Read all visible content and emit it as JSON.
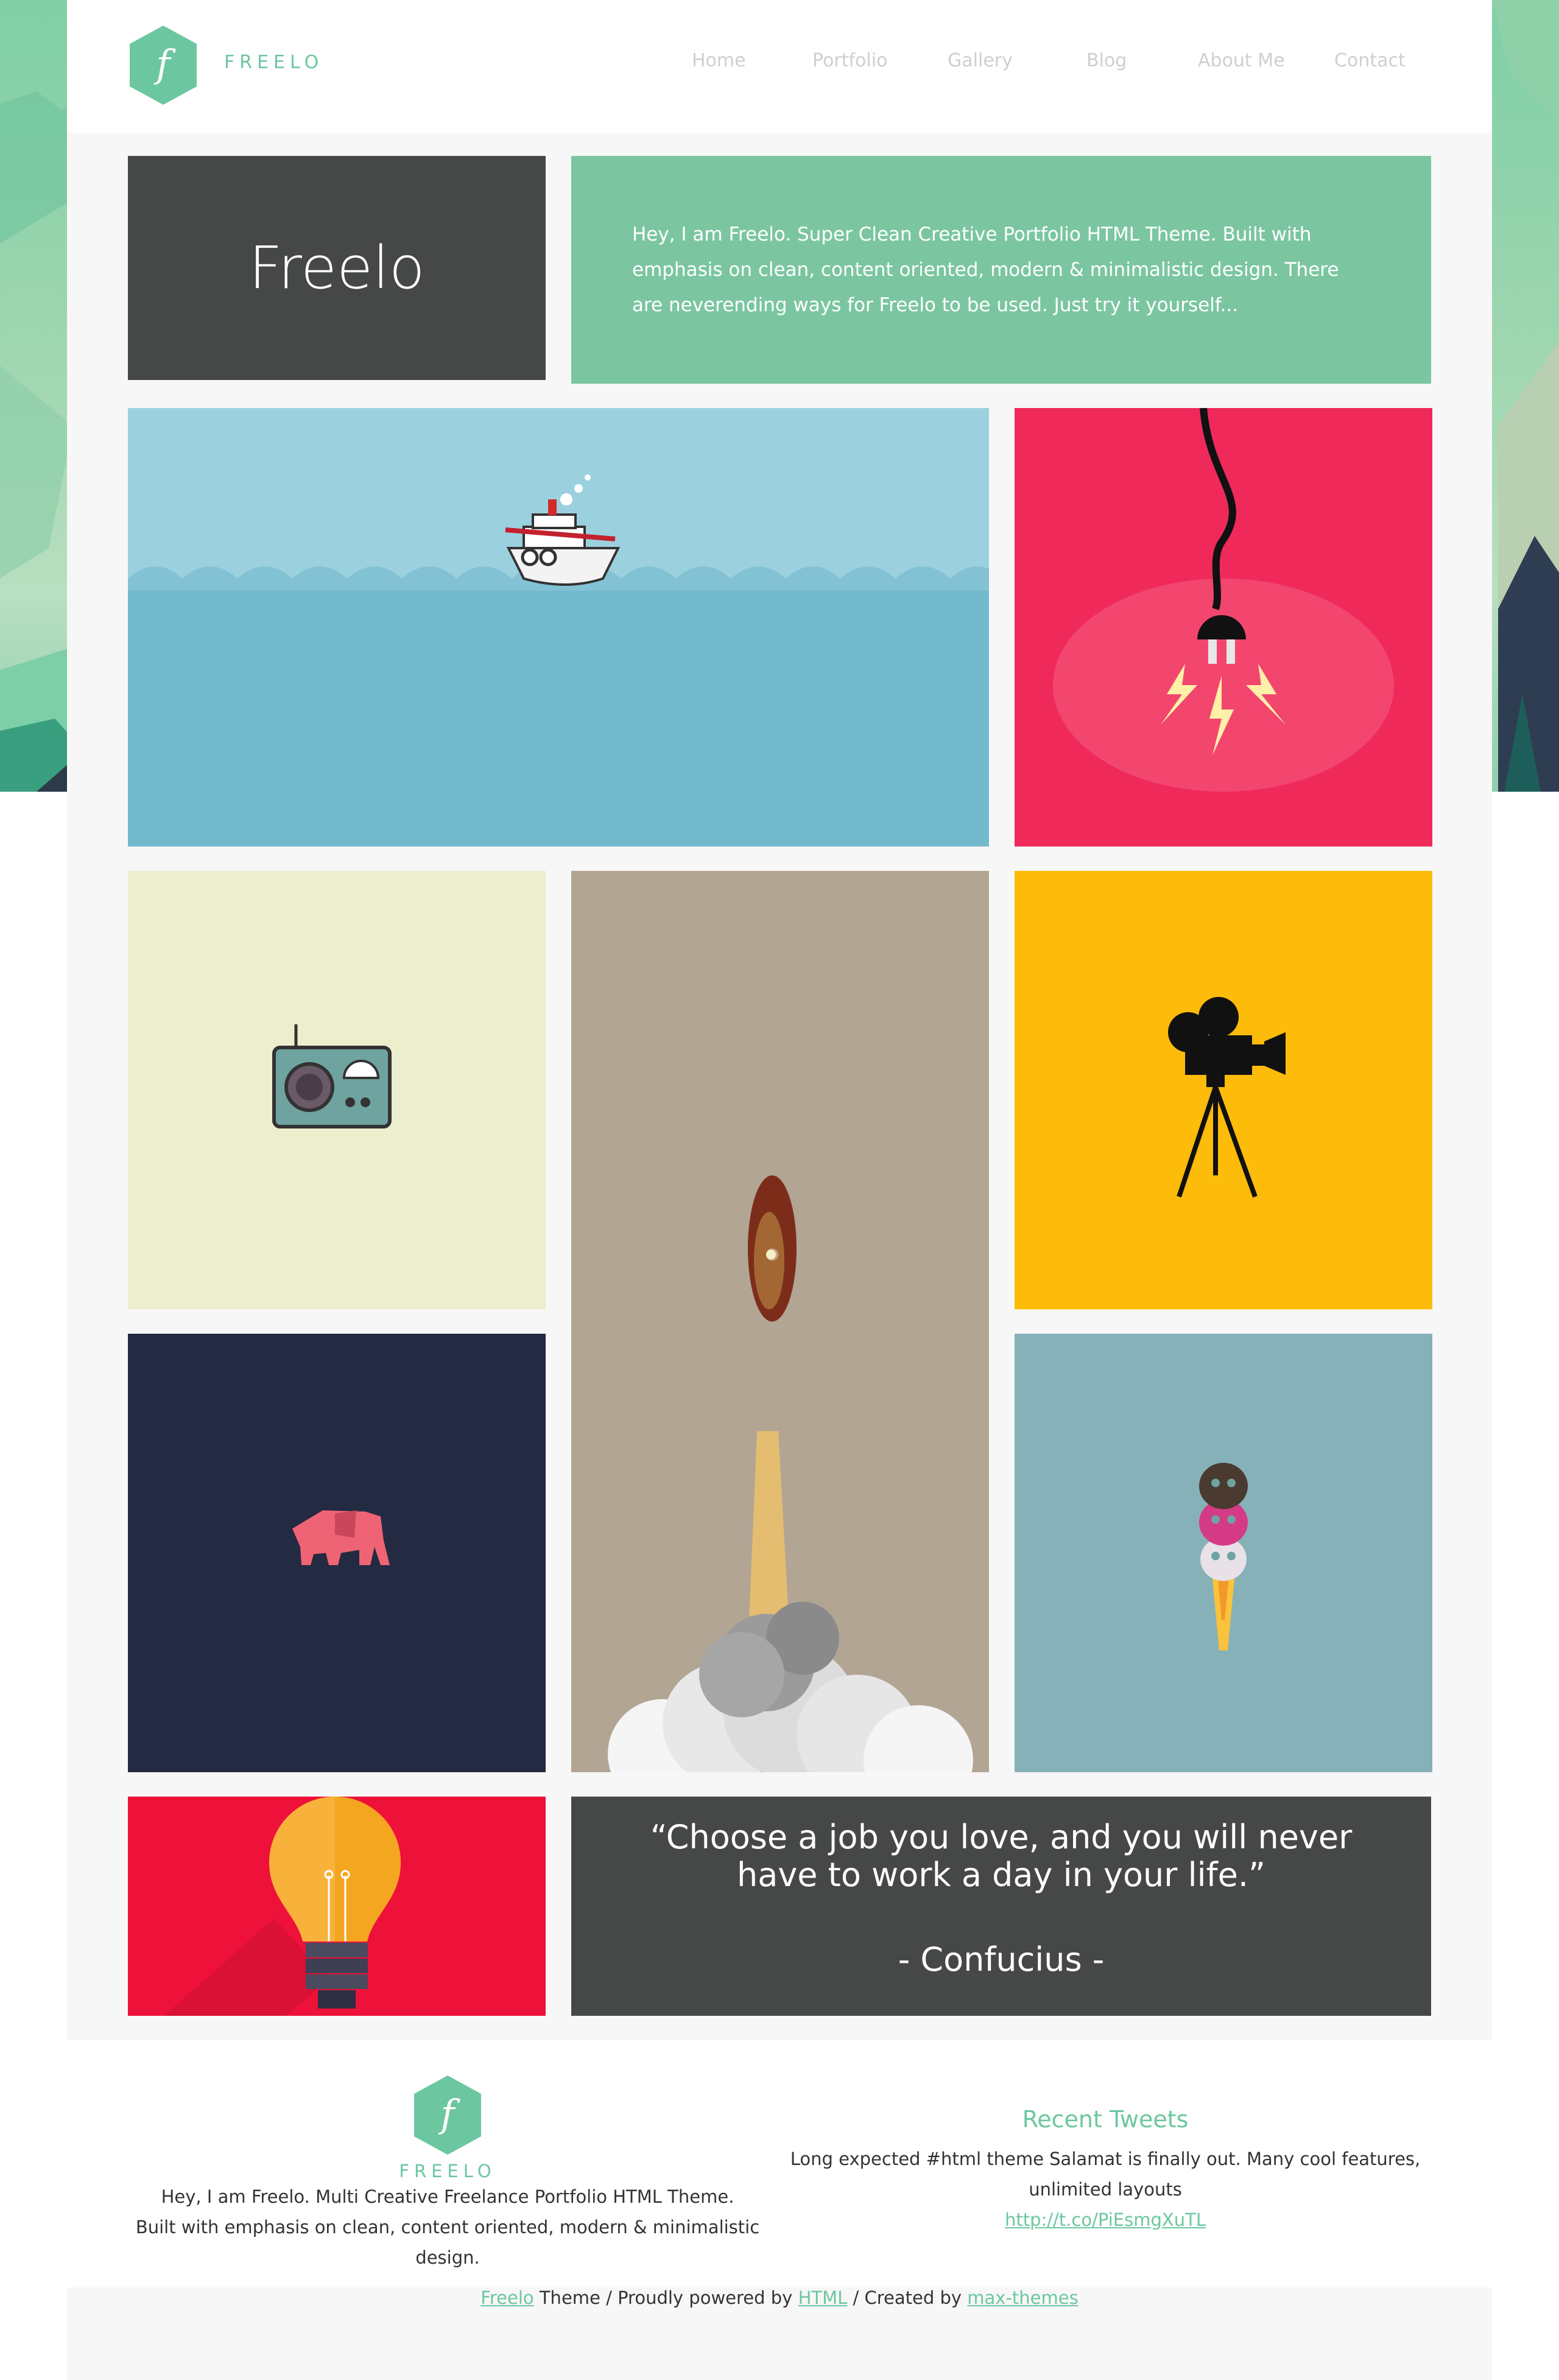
{
  "header": {
    "logo_letter": "f",
    "brand": "FREELO",
    "nav": [
      "Home",
      "Portfolio",
      "Gallery",
      "Blog",
      "About Me",
      "Contact"
    ]
  },
  "hero": {
    "title": "Freelo",
    "intro": "Hey, I am Freelo. Super Clean Creative Portfolio HTML Theme. Built with emphasis on clean, content oriented, modern & minimalistic design. There are neverending ways for Freelo to be used. Just try it yourself..."
  },
  "portfolio": {
    "items": [
      {
        "icon": "boat-illustration",
        "color": "#7fc4d6"
      },
      {
        "icon": "plug-illustration",
        "color": "#ef2a5a"
      },
      {
        "icon": "radio-illustration",
        "color": "#eceecd"
      },
      {
        "icon": "rocket-man-illustration",
        "color": "#b3a594"
      },
      {
        "icon": "movie-camera-illustration",
        "color": "#fdbb0a"
      },
      {
        "icon": "elephant-illustration",
        "color": "#232a42"
      },
      {
        "icon": "skull-rocket-illustration",
        "color": "#86b1b8"
      },
      {
        "icon": "lightbulb-illustration",
        "color": "#ee1139"
      }
    ]
  },
  "quote": {
    "text": "“Choose a job you love, and you will never have to work a day in your life.”",
    "author": "- Confucius -"
  },
  "footer": {
    "logo_letter": "f",
    "brand": "FREELO",
    "about_line1": "Hey, I am Freelo. Multi Creative Freelance Portfolio HTML Theme.",
    "about_line2": "Built with emphasis on clean, content oriented, modern & minimalistic design.",
    "tweets_title": "Recent Tweets",
    "tweet_text": "Long expected #html theme Salamat is finally out. Many cool features, unlimited layouts",
    "tweet_link": "http://t.co/PiEsmgXuTL"
  },
  "copyright": {
    "brand_link": "Freelo",
    "text1": " Theme / Proudly powered by ",
    "html_link": "HTML",
    "text2": " / Created by ",
    "author_link": "max-themes"
  },
  "colors": {
    "accent": "#6cc7a0",
    "dark_tile": "#454846",
    "intro_tile": "#7bc6a1"
  }
}
